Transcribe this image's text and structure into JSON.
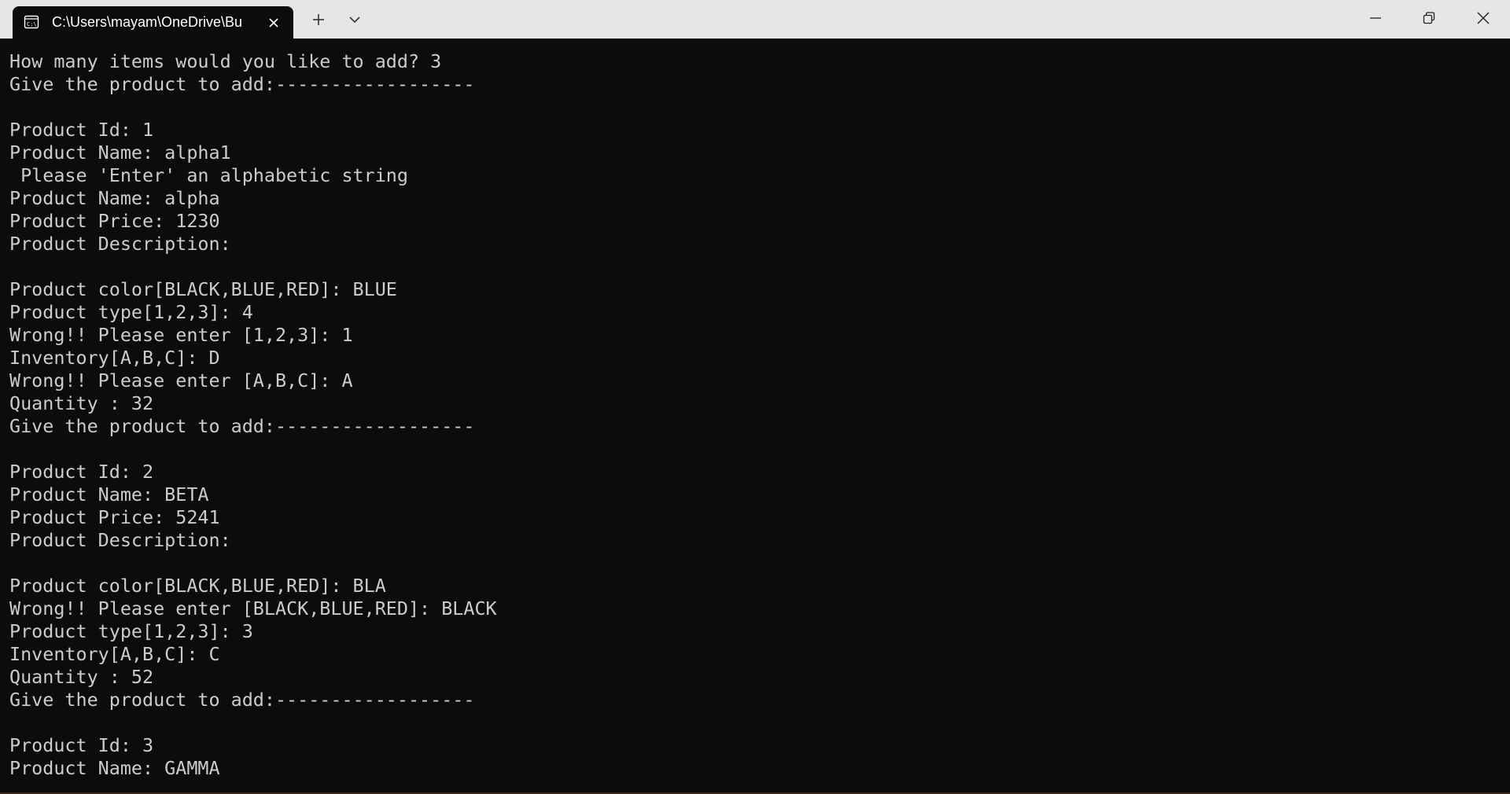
{
  "window": {
    "tab_title": "C:\\Users\\mayam\\OneDrive\\Bu",
    "icons": {
      "tab": "terminal-icon",
      "tab_close": "close-icon",
      "new_tab": "plus-icon",
      "dropdown": "chevron-down-icon",
      "minimize": "minimize-icon",
      "restore": "restore-icon",
      "close": "close-icon"
    }
  },
  "terminal": {
    "background": "#0c0c0c",
    "foreground": "#cccccc",
    "lines": [
      "How many items would you like to add? 3",
      "Give the product to add:------------------",
      "",
      "Product Id: 1",
      "Product Name: alpha1",
      " Please 'Enter' an alphabetic string",
      "Product Name: alpha",
      "Product Price: 1230",
      "Product Description:",
      "",
      "Product color[BLACK,BLUE,RED]: BLUE",
      "Product type[1,2,3]: 4",
      "Wrong!! Please enter [1,2,3]: 1",
      "Inventory[A,B,C]: D",
      "Wrong!! Please enter [A,B,C]: A",
      "Quantity : 32",
      "Give the product to add:------------------",
      "",
      "Product Id: 2",
      "Product Name: BETA",
      "Product Price: 5241",
      "Product Description:",
      "",
      "Product color[BLACK,BLUE,RED]: BLA",
      "Wrong!! Please enter [BLACK,BLUE,RED]: BLACK",
      "Product type[1,2,3]: 3",
      "Inventory[A,B,C]: C",
      "Quantity : 52",
      "Give the product to add:------------------",
      "",
      "Product Id: 3",
      "Product Name: GAMMA"
    ]
  }
}
